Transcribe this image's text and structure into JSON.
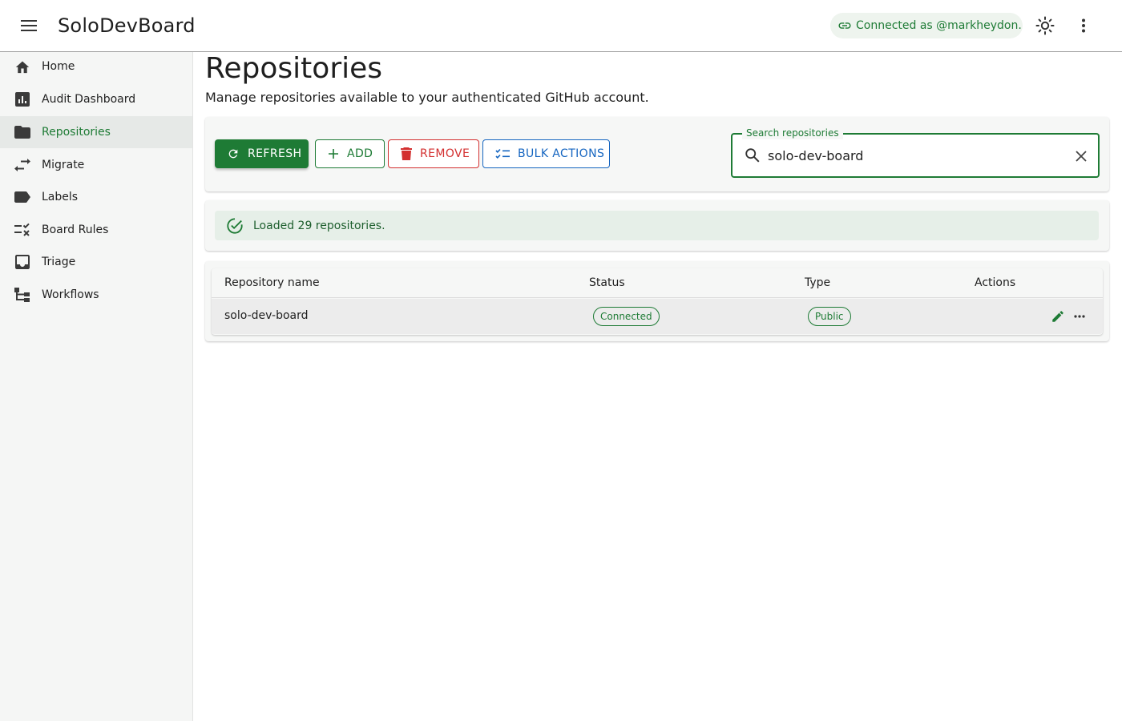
{
  "app": {
    "title": "SoloDevBoard",
    "connection": "Connected as @markheydon."
  },
  "sidebar": {
    "items": [
      {
        "label": "Home",
        "icon": "home-icon"
      },
      {
        "label": "Audit Dashboard",
        "icon": "chart-icon"
      },
      {
        "label": "Repositories",
        "icon": "folder-icon",
        "active": true
      },
      {
        "label": "Migrate",
        "icon": "swap-icon"
      },
      {
        "label": "Labels",
        "icon": "label-icon"
      },
      {
        "label": "Board Rules",
        "icon": "rule-icon"
      },
      {
        "label": "Triage",
        "icon": "inbox-icon"
      },
      {
        "label": "Workflows",
        "icon": "workflow-icon"
      }
    ]
  },
  "page": {
    "title": "Repositories",
    "subtitle": "Manage repositories available to your authenticated GitHub account."
  },
  "toolbar": {
    "refresh_label": "REFRESH",
    "add_label": "ADD",
    "remove_label": "REMOVE",
    "bulk_label": "BULK ACTIONS"
  },
  "search": {
    "label": "Search repositories",
    "value": "solo-dev-board"
  },
  "alert": {
    "message": "Loaded 29 repositories."
  },
  "table": {
    "headers": [
      "Repository name",
      "Status",
      "Type",
      "Actions"
    ],
    "rows": [
      {
        "name": "solo-dev-board",
        "status": "Connected",
        "type": "Public"
      }
    ]
  },
  "colors": {
    "primary": "#1e7b35",
    "error": "#d32f2f",
    "info": "#1565c0"
  }
}
